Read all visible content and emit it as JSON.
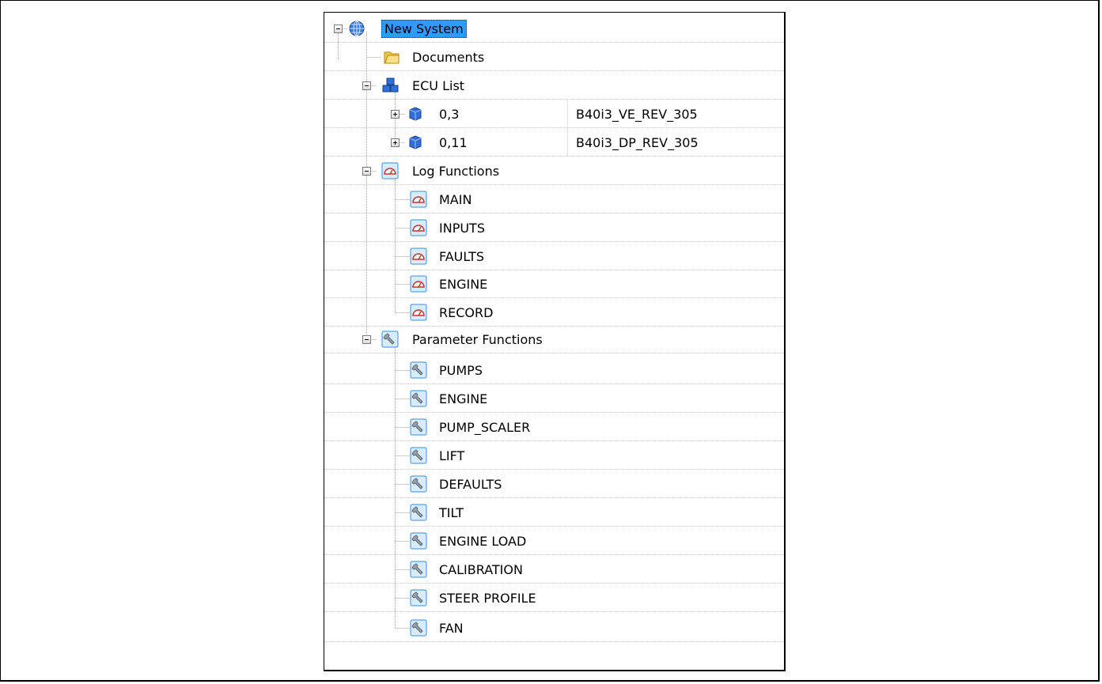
{
  "tree": {
    "root": {
      "label": "New System",
      "icon": "globe-icon",
      "expanded": true,
      "selected": true
    },
    "documents": {
      "label": "Documents",
      "icon": "folder-icon"
    },
    "ecu_list": {
      "label": "ECU List",
      "icon": "ecu-list-icon",
      "expanded": true,
      "items": [
        {
          "label": "0,3",
          "value": "B40i3_VE_REV_305",
          "icon": "ecu-cube-icon",
          "expanded": false
        },
        {
          "label": "0,11",
          "value": "B40i3_DP_REV_305",
          "icon": "ecu-cube-icon",
          "expanded": false
        }
      ]
    },
    "log_functions": {
      "label": "Log Functions",
      "icon": "gauge-icon",
      "expanded": true,
      "items": [
        "MAIN",
        "INPUTS",
        "FAULTS",
        "ENGINE",
        "RECORD"
      ]
    },
    "parameter_functions": {
      "label": "Parameter Functions",
      "icon": "wrench-icon",
      "expanded": true,
      "items": [
        "PUMPS",
        "ENGINE",
        "PUMP_SCALER",
        "LIFT",
        "DEFAULTS",
        "TILT",
        "ENGINE LOAD",
        "CALIBRATION",
        "STEER PROFILE",
        "FAN"
      ]
    }
  }
}
